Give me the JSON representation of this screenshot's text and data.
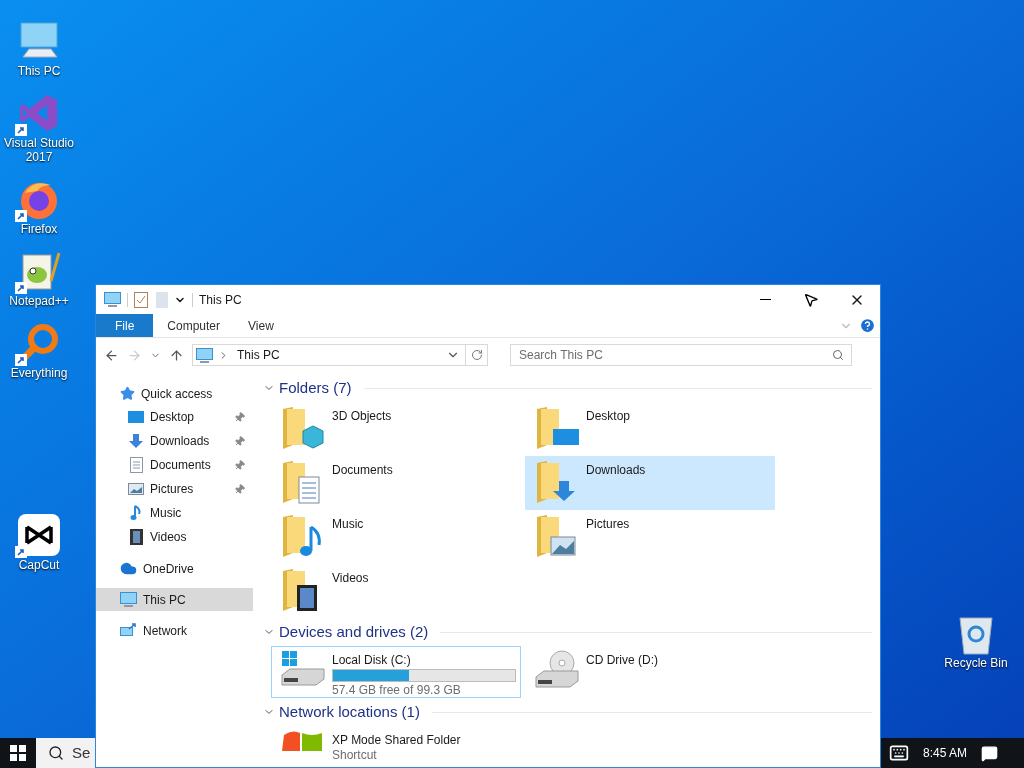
{
  "desktop": {
    "icons": [
      {
        "label": "This PC",
        "kind": "pc",
        "shortcut": false
      },
      {
        "label": "Visual Studio 2017",
        "kind": "vs",
        "shortcut": true
      },
      {
        "label": "Firefox",
        "kind": "firefox",
        "shortcut": true
      },
      {
        "label": "Notepad++",
        "kind": "notepad",
        "shortcut": true
      },
      {
        "label": "Everything",
        "kind": "everything",
        "shortcut": true
      },
      {
        "label": "CapCut",
        "kind": "capcut",
        "shortcut": true
      }
    ],
    "recycle_bin": {
      "label": "Recycle Bin"
    }
  },
  "window": {
    "title": "This PC",
    "ribbon_tabs": [
      {
        "label": "File",
        "selected": true
      },
      {
        "label": "Computer",
        "selected": false
      },
      {
        "label": "View",
        "selected": false
      }
    ],
    "address": {
      "path": "This PC",
      "search_placeholder": "Search This PC",
      "forward_disabled": true
    },
    "nav": [
      {
        "label": "Quick access",
        "kind": "star",
        "selected": false,
        "children": [
          {
            "label": "Desktop",
            "kind": "desktop",
            "pinned": true,
            "selected": false
          },
          {
            "label": "Downloads",
            "kind": "downloads",
            "pinned": true,
            "selected": false
          },
          {
            "label": "Documents",
            "kind": "documents",
            "pinned": true,
            "selected": false
          },
          {
            "label": "Pictures",
            "kind": "pictures",
            "pinned": true,
            "selected": false
          },
          {
            "label": "Music",
            "kind": "music",
            "pinned": false,
            "selected": false
          },
          {
            "label": "Videos",
            "kind": "videos",
            "pinned": false,
            "selected": false
          }
        ]
      },
      {
        "label": "OneDrive",
        "kind": "cloud",
        "selected": false
      },
      {
        "label": "This PC",
        "kind": "pc",
        "selected": true
      },
      {
        "label": "Network",
        "kind": "network",
        "selected": false
      }
    ],
    "sections": [
      {
        "title": "Folders (7)",
        "expanded": true,
        "items": [
          {
            "kind": "objects",
            "label": "3D Objects",
            "selected": false
          },
          {
            "kind": "desktop",
            "label": "Desktop",
            "selected": false
          },
          {
            "kind": "documents",
            "label": "Documents",
            "selected": false
          },
          {
            "kind": "downloads",
            "label": "Downloads",
            "selected": true
          },
          {
            "kind": "music",
            "label": "Music",
            "selected": false
          },
          {
            "kind": "pictures",
            "label": "Pictures",
            "selected": false
          },
          {
            "kind": "videos",
            "label": "Videos",
            "selected": false
          }
        ]
      },
      {
        "title": "Devices and drives (2)",
        "expanded": true,
        "items": [
          {
            "kind": "disk",
            "label": "Local Disk (C:)",
            "level": 0.42,
            "detail": "57.4 GB free of 99.3 GB",
            "selected": false,
            "hovered": true
          },
          {
            "kind": "cd",
            "label": "CD Drive (D:)",
            "selected": false,
            "hovered": false
          }
        ]
      },
      {
        "title": "Network locations (1)",
        "expanded": true,
        "items": [
          {
            "kind": "xp",
            "label": "XP Mode Shared Folder",
            "detail": "Shortcut",
            "selected": false
          }
        ]
      }
    ]
  },
  "taskbar": {
    "search": "Se",
    "time": "8:45 AM"
  }
}
